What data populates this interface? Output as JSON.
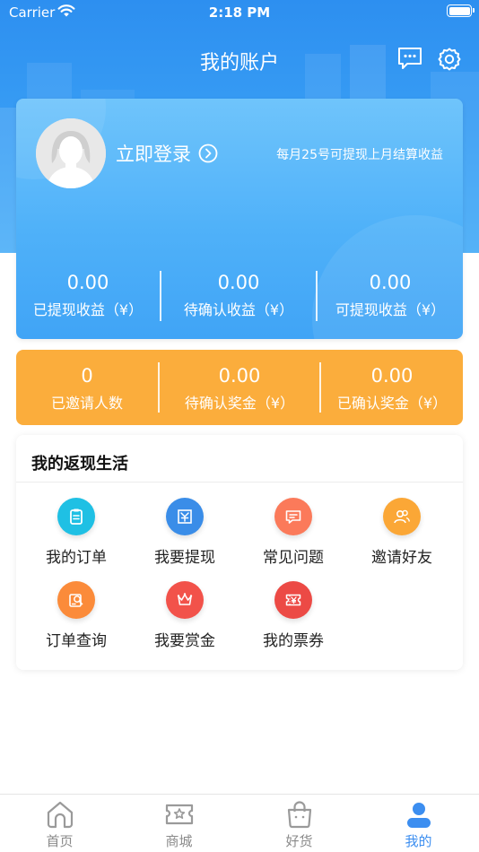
{
  "status_bar": {
    "carrier": "Carrier",
    "time": "2:18 PM"
  },
  "header": {
    "title": "我的账户"
  },
  "account": {
    "login_label": "立即登录",
    "withdraw_note": "每月25号可提现上月结算收益",
    "stats": [
      {
        "value": "0.00",
        "label": "已提现收益（¥）"
      },
      {
        "value": "0.00",
        "label": "待确认收益（¥）"
      },
      {
        "value": "0.00",
        "label": "可提现收益（¥）"
      }
    ]
  },
  "invite": {
    "stats": [
      {
        "value": "0",
        "label": "已邀请人数"
      },
      {
        "value": "0.00",
        "label": "待确认奖金（¥）"
      },
      {
        "value": "0.00",
        "label": "已确认奖金（¥）"
      }
    ]
  },
  "cashback": {
    "title": "我的返现生活",
    "items": [
      {
        "label": "我的订单",
        "icon": "order-icon",
        "color": "#1fc0e4"
      },
      {
        "label": "我要提现",
        "icon": "withdraw-icon",
        "color": "#3a8de8"
      },
      {
        "label": "常见问题",
        "icon": "faq-icon",
        "color": "#fb7a5a"
      },
      {
        "label": "邀请好友",
        "icon": "invite-friends-icon",
        "color": "#fba736"
      },
      {
        "label": "订单查询",
        "icon": "order-search-icon",
        "color": "#fb8b3a"
      },
      {
        "label": "我要赏金",
        "icon": "reward-icon",
        "color": "#f2524a"
      },
      {
        "label": "我的票券",
        "icon": "ticket-icon",
        "color": "#ec4a45"
      }
    ]
  },
  "tabs": [
    {
      "label": "首页",
      "icon": "home-icon",
      "active": false
    },
    {
      "label": "商城",
      "icon": "mall-icon",
      "active": false
    },
    {
      "label": "好货",
      "icon": "shopping-bag-icon",
      "active": false
    },
    {
      "label": "我的",
      "icon": "profile-icon",
      "active": true
    }
  ],
  "colors": {
    "primary_blue": "#2d8ff0",
    "orange": "#fbad3c",
    "tab_active": "#3c8ef0"
  }
}
